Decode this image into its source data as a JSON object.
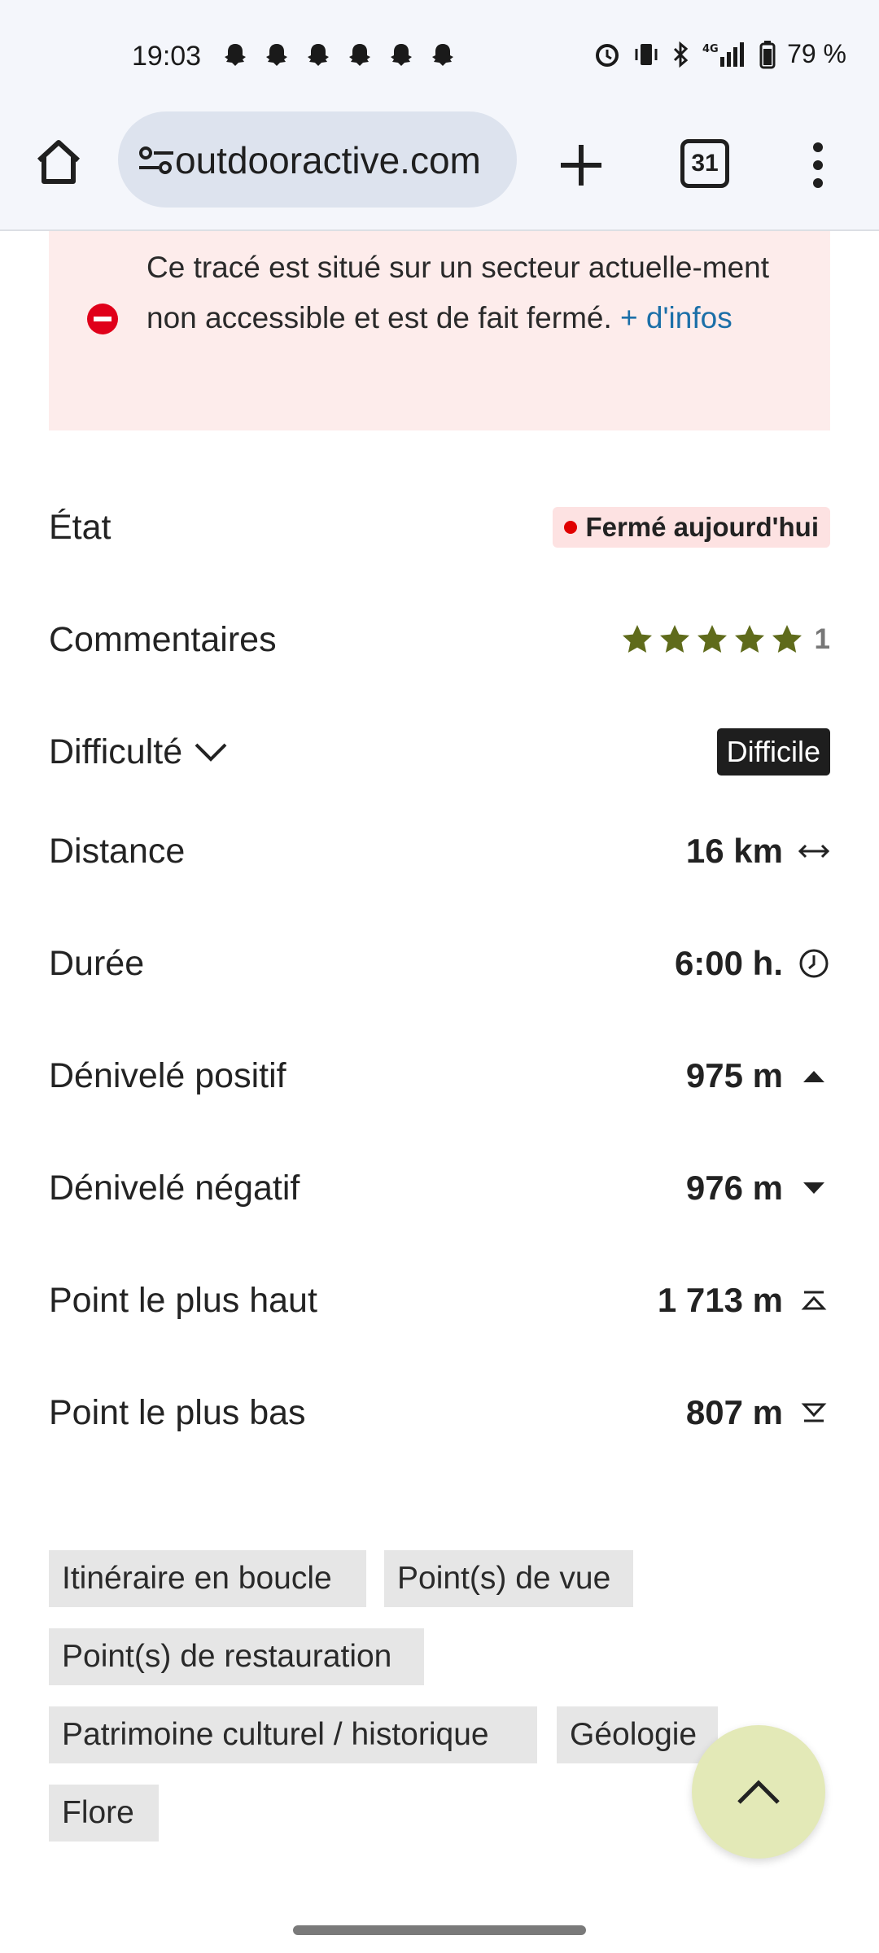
{
  "status_bar": {
    "time": "19:03",
    "battery": "79 %",
    "notification_icons": [
      "snapchat-icon",
      "snapchat-icon",
      "snapchat-icon",
      "snapchat-icon",
      "snapchat-icon",
      "snapchat-icon"
    ]
  },
  "browser": {
    "url": "outdooractive.com",
    "tab_count": "31"
  },
  "alert": {
    "message": "Ce tracé est situé sur un secteur actuelle-ment non accessible et est de fait fermé.",
    "link": "+ d'infos"
  },
  "details": {
    "etat": {
      "label": "État",
      "value": "Fermé aujourd'hui"
    },
    "commentaires": {
      "label": "Commentaires",
      "rating": 5,
      "count": "1"
    },
    "difficulte": {
      "label": "Difficulté",
      "value": "Difficile"
    },
    "distance": {
      "label": "Distance",
      "value": "16 km"
    },
    "duree": {
      "label": "Durée",
      "value": "6:00 h."
    },
    "denivele_positif": {
      "label": "Dénivelé positif",
      "value": "975 m"
    },
    "denivele_negatif": {
      "label": "Dénivelé négatif",
      "value": "976 m"
    },
    "point_haut": {
      "label": "Point le plus haut",
      "value": "1 713 m"
    },
    "point_bas": {
      "label": "Point le plus bas",
      "value": "807 m"
    }
  },
  "tags": [
    "Itinéraire en boucle",
    "Point(s) de vue",
    "Point(s) de restauration",
    "Patrimoine culturel / historique",
    "Géologie",
    "Flore"
  ],
  "colors": {
    "alert_bg": "#fdeceb",
    "star": "#5f6b1b",
    "link": "#1b6fa8",
    "fab": "#e3e9b7"
  }
}
